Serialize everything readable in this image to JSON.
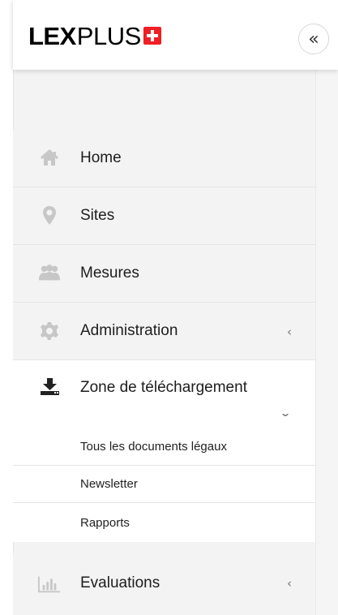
{
  "brand": {
    "name_bold": "LEX",
    "name_light": "PLUS",
    "flag_icon": "swiss-flag-icon",
    "accent_color": "#ef1f24"
  },
  "topbar": {
    "collapse_label": "«"
  },
  "navigation": {
    "items": [
      {
        "label": "Home",
        "icon": "home-icon"
      },
      {
        "label": "Sites",
        "icon": "map-marker-icon"
      },
      {
        "label": "Mesures",
        "icon": "users-icon"
      },
      {
        "label": "Administration",
        "icon": "gear-icon",
        "chevron": "‹"
      },
      {
        "label": "Zone de téléchargement",
        "icon": "download-icon",
        "chevron": "⌄",
        "active": true
      },
      {
        "label": "Evaluations",
        "icon": "bar-chart-icon",
        "chevron": "‹"
      }
    ],
    "submenu": [
      {
        "label": "Tous les documents légaux"
      },
      {
        "label": "Newsletter"
      },
      {
        "label": "Rapports"
      }
    ]
  },
  "colors": {
    "sidebar_background": "#f3f3f3",
    "active_background": "#ffffff",
    "muted_icon": "#c7c7c7",
    "active_icon": "#222222"
  }
}
